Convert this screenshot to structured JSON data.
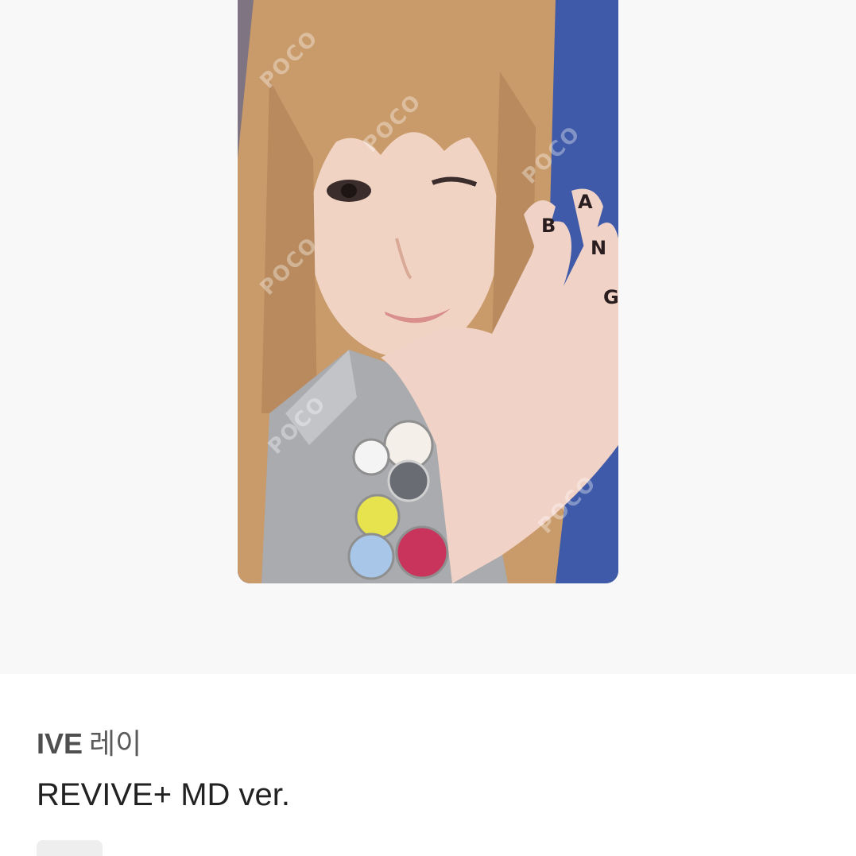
{
  "product": {
    "artist": "IVE",
    "member": "레이",
    "title": "REVIVE+ MD ver."
  },
  "photo": {
    "description_icon": "photocard-image",
    "watermark_text": "POCO",
    "nail_letters": [
      "B",
      "A",
      "N",
      "G"
    ],
    "colors": {
      "background": "#3f5aa8",
      "hair": "#c99a6a",
      "skin": "#f1d3c4",
      "shirt": "#a9abaf"
    }
  },
  "colors": {
    "stage_background": "#f8f8f9",
    "title_text": "#222222",
    "artist_text": "#4f4f4f",
    "chip": "#eeeeee"
  }
}
